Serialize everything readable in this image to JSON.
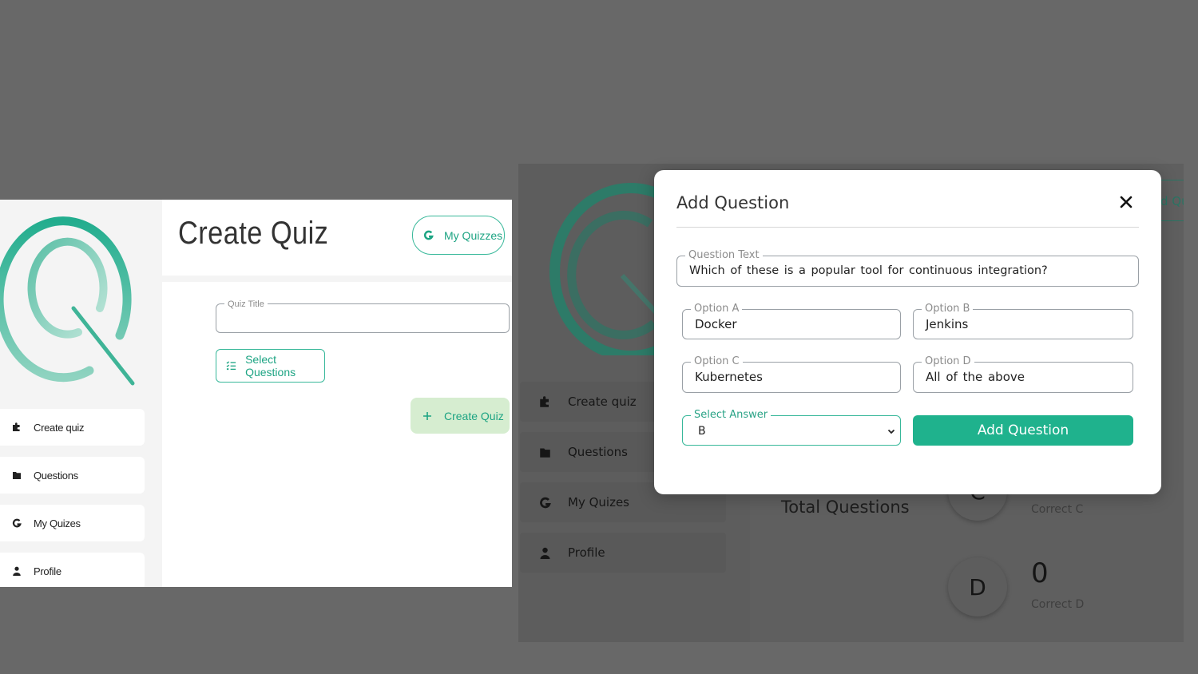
{
  "left_screen": {
    "page_title": "Create Quiz",
    "my_quizzes_button": "My Quizzes",
    "quiz_title_field": {
      "label": "Quiz Title",
      "value": ""
    },
    "select_questions_button": "Select Questions",
    "create_quiz_button": "Create Quiz",
    "sidebar": {
      "items": [
        {
          "label": "Create quiz",
          "icon": "puzzle-icon"
        },
        {
          "label": "Questions",
          "icon": "folder-icon"
        },
        {
          "label": "My Quizes",
          "icon": "logo-g-icon"
        },
        {
          "label": "Profile",
          "icon": "user-icon"
        }
      ]
    }
  },
  "right_screen": {
    "sidebar": {
      "items": [
        {
          "label": "Create quiz",
          "icon": "puzzle-icon"
        },
        {
          "label": "Questions",
          "icon": "folder-icon"
        },
        {
          "label": "My Quizes",
          "icon": "logo-g-icon"
        },
        {
          "label": "Profile",
          "icon": "user-icon"
        }
      ]
    },
    "top_button_partial": "d Qu",
    "total_questions_label": "Total Questions",
    "stats": [
      {
        "letter": "C",
        "count": "",
        "label": "Correct C"
      },
      {
        "letter": "D",
        "count": "0",
        "label": "Correct D"
      }
    ]
  },
  "modal": {
    "title": "Add Question",
    "question_text": {
      "label": "Question Text",
      "value": "Which of these is a popular tool for continuous integration?"
    },
    "option_a": {
      "label": "Option A",
      "value": "Docker"
    },
    "option_b": {
      "label": "Option B",
      "value": "Jenkins"
    },
    "option_c": {
      "label": "Option C",
      "value": "Kubernetes"
    },
    "option_d": {
      "label": "Option D",
      "value": "All of the above"
    },
    "select_answer": {
      "label": "Select Answer",
      "value": "B"
    },
    "add_button": "Add Question"
  },
  "colors": {
    "accent": "#1fb28d",
    "accent_text": "#1da483",
    "create_button_bg": "#d6edd0",
    "overlay": "#686868"
  }
}
